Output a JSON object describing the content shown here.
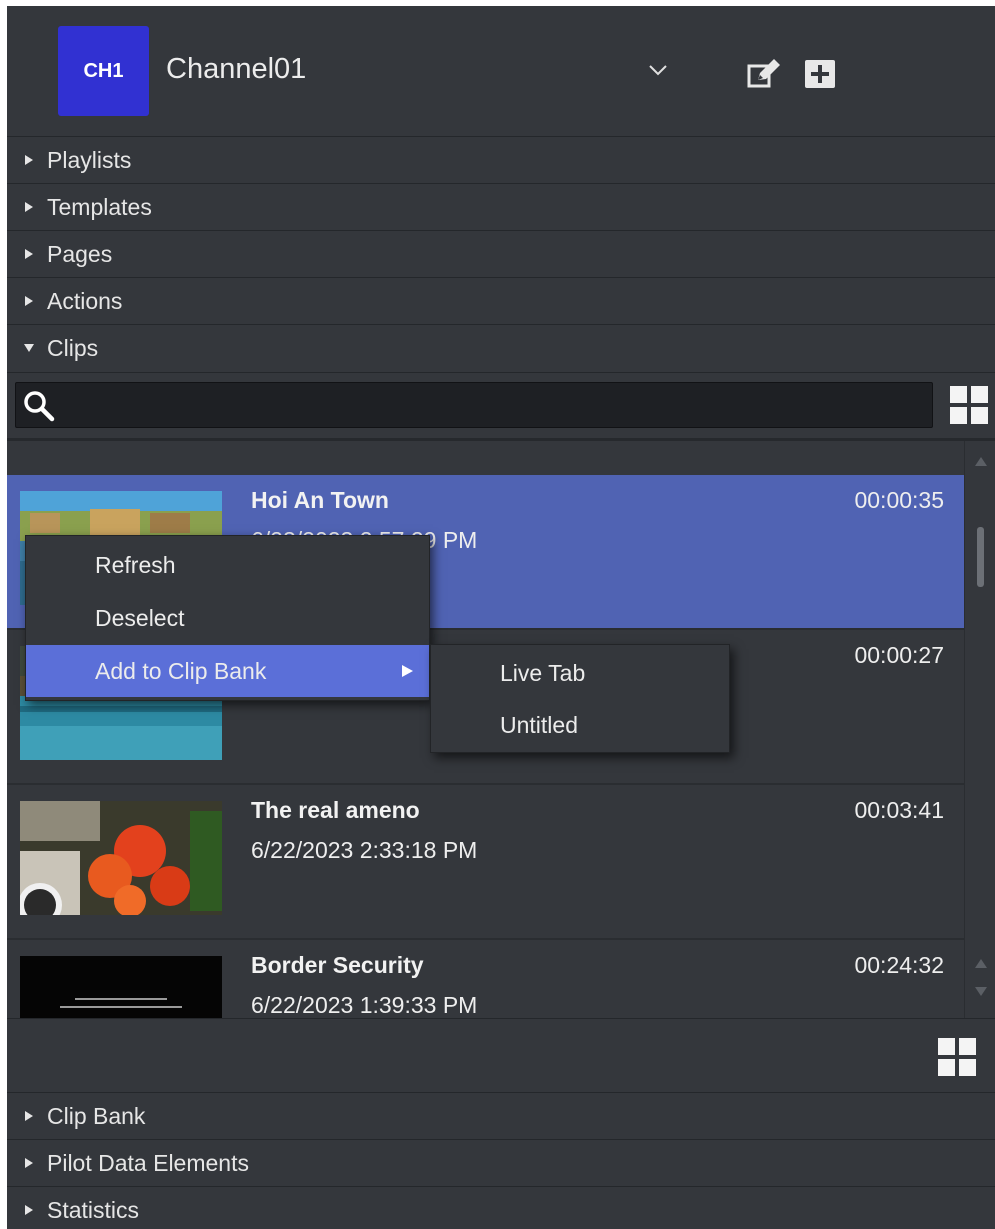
{
  "channel": {
    "badge": "CH1",
    "name": "Channel01"
  },
  "sections_top": [
    {
      "label": "Playlists",
      "expanded": false
    },
    {
      "label": "Templates",
      "expanded": false
    },
    {
      "label": "Pages",
      "expanded": false
    },
    {
      "label": "Actions",
      "expanded": false
    },
    {
      "label": "Clips",
      "expanded": true
    }
  ],
  "search": {
    "value": "",
    "placeholder": ""
  },
  "clips": [
    {
      "title": "Hoi An Town",
      "date": "6/23/2023 2:57:29 PM",
      "duration": "00:00:35",
      "selected": true
    },
    {
      "title": "",
      "date": "",
      "duration": "00:00:27",
      "selected": false
    },
    {
      "title": "The real ameno",
      "date": "6/22/2023 2:33:18 PM",
      "duration": "00:03:41",
      "selected": false
    },
    {
      "title": "Border Security",
      "date": "6/22/2023 1:39:33 PM",
      "duration": "00:24:32",
      "selected": false
    }
  ],
  "context_menu": {
    "items": [
      "Refresh",
      "Deselect",
      "Add to Clip Bank"
    ],
    "submenu": [
      "Live Tab",
      "Untitled"
    ]
  },
  "sections_bottom": [
    {
      "label": "Clip Bank",
      "expanded": false
    },
    {
      "label": "Pilot Data Elements",
      "expanded": false
    },
    {
      "label": "Statistics",
      "expanded": false
    }
  ],
  "colors": {
    "panel": "#34373c",
    "badge": "#3131d2",
    "selected_row": "#5063b3",
    "menu_highlight": "#5b6fd8"
  }
}
